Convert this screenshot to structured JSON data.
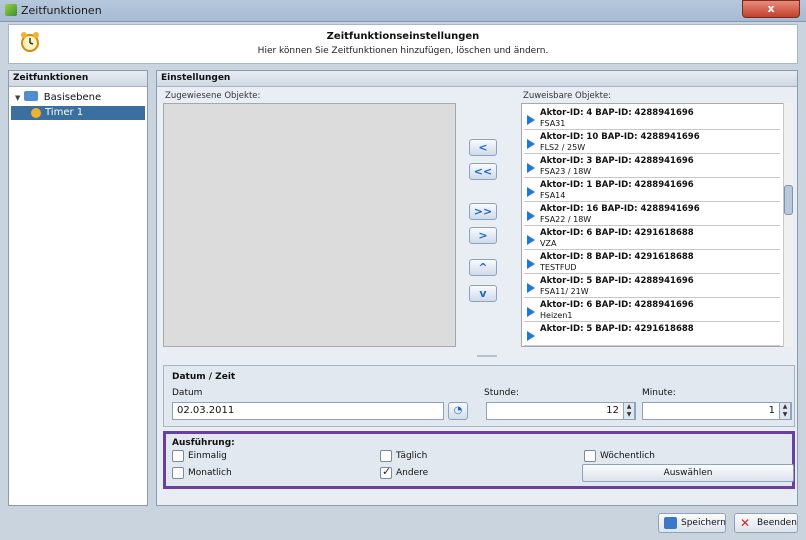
{
  "window": {
    "title": "Zeitfunktionen",
    "close_label": "x"
  },
  "header": {
    "title": "Zeitfunktionseinstellungen",
    "subtitle": "Hier können Sie Zeitfunktionen hinzufügen, löschen und ändern."
  },
  "left_panel": {
    "heading": "Zeitfunktionen",
    "tree": {
      "root": "Basisebene",
      "child": "Timer 1"
    }
  },
  "main": {
    "heading": "Einstellungen",
    "assigned_label": "Zugewiesene Objekte:",
    "assignable_label": "Zuweisbare Objekte:",
    "assignable": [
      {
        "title": "Aktor-ID: 4 BAP-ID: 4288941696",
        "sub": "FSA31"
      },
      {
        "title": "Aktor-ID: 10 BAP-ID: 4288941696",
        "sub": "FLS2 / 25W"
      },
      {
        "title": "Aktor-ID: 3 BAP-ID: 4288941696",
        "sub": "FSA23 / 18W"
      },
      {
        "title": "Aktor-ID: 1 BAP-ID: 4288941696",
        "sub": "FSA14"
      },
      {
        "title": "Aktor-ID: 16 BAP-ID: 4288941696",
        "sub": "FSA22 / 18W"
      },
      {
        "title": "Aktor-ID: 6 BAP-ID: 4291618688",
        "sub": "VZA"
      },
      {
        "title": "Aktor-ID: 8 BAP-ID: 4291618688",
        "sub": "TESTFUD"
      },
      {
        "title": "Aktor-ID: 5 BAP-ID: 4288941696",
        "sub": "FSA11/ 21W"
      },
      {
        "title": "Aktor-ID: 6 BAP-ID: 4288941696",
        "sub": "Heizen1"
      },
      {
        "title": "Aktor-ID: 5 BAP-ID: 4291618688",
        "sub": ""
      }
    ],
    "move_buttons": [
      "<",
      "<<",
      ">>",
      ">",
      "^",
      "v"
    ]
  },
  "datetime": {
    "group_label": "Datum / Zeit",
    "datum_label": "Datum",
    "datum_value": "02.03.2011",
    "stunde_label": "Stunde:",
    "stunde_value": "12",
    "minute_label": "Minute:",
    "minute_value": "1"
  },
  "execution": {
    "group_label": "Ausführung:",
    "options": {
      "einmalig": {
        "label": "Einmalig",
        "checked": false
      },
      "taeglich": {
        "label": "Täglich",
        "checked": false
      },
      "woechentlich": {
        "label": "Wöchentlich",
        "checked": false
      },
      "monatlich": {
        "label": "Monatlich",
        "checked": false
      },
      "andere": {
        "label": "Andere",
        "checked": true
      }
    },
    "select_button": "Auswählen"
  },
  "footer": {
    "save_label": "Speichern",
    "quit_label": "Beenden"
  },
  "colors": {
    "accent": "#3a6fa0",
    "highlight_border": "#6b3fa0",
    "arrow_blue": "#1e78d6"
  }
}
